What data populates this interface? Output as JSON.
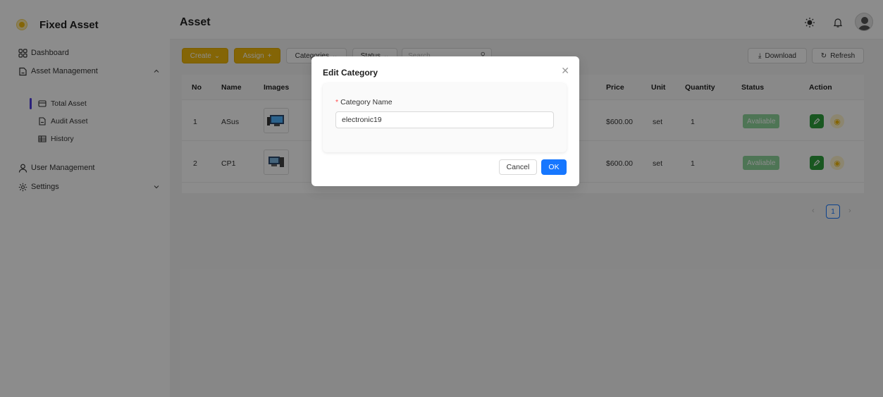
{
  "app": {
    "logo_text": "Fixed Asset"
  },
  "sidebar": {
    "items": [
      {
        "label": "Dashboard",
        "icon": "dashboard-grid-icon"
      },
      {
        "label": "Asset Management",
        "icon": "document-icon",
        "expanded": true,
        "children": [
          {
            "label": "Total Asset",
            "icon": "box-icon",
            "active": true
          },
          {
            "label": "Audit Asset",
            "icon": "document-icon"
          },
          {
            "label": "History",
            "icon": "table-icon"
          }
        ]
      },
      {
        "label": "User Management",
        "icon": "user-icon"
      },
      {
        "label": "Settings",
        "icon": "gear-icon"
      }
    ]
  },
  "header": {
    "title": "Asset"
  },
  "toolbar": {
    "create_label": "Create",
    "assign_label": "Assign",
    "categories_label": "Categories",
    "status_label": "Status",
    "search_placeholder": "Search",
    "download_label": "Download",
    "refresh_label": "Refresh"
  },
  "table": {
    "columns": [
      "No",
      "Name",
      "Images",
      "Price",
      "Unit",
      "Quantity",
      "Status",
      "Action"
    ],
    "rows": [
      {
        "no": "1",
        "name": "ASus",
        "price": "$600.00",
        "unit": "set",
        "quantity": "1",
        "status": "Avaliable"
      },
      {
        "no": "2",
        "name": "CP1",
        "price": "$600.00",
        "unit": "set",
        "quantity": "1",
        "status": "Avaliable"
      }
    ]
  },
  "pagination": {
    "current": "1"
  },
  "modal": {
    "title": "Edit Category",
    "field_label": "Category Name",
    "required_mark": "*",
    "field_value": "electronic19",
    "cancel_label": "Cancel",
    "ok_label": "OK"
  },
  "colors": {
    "accent": "#f0b90b",
    "primary": "#1677ff",
    "active_bar": "#4f3ce0",
    "status_green": "#8ed59c",
    "edit_green": "#2e9e3d"
  }
}
